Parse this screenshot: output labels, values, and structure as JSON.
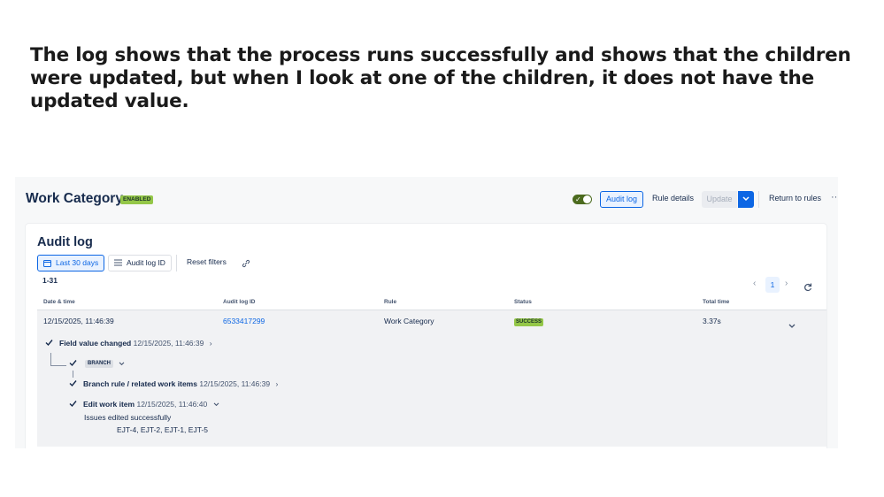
{
  "headline": "The log shows that the process runs successfully and shows that the children were updated, but when I look at one of the children, it does not have the updated value.",
  "header": {
    "title": "Work Category",
    "status_badge": "ENABLED",
    "audit_log_button": "Audit log",
    "rule_details_button": "Rule details",
    "update_button": "Update",
    "return_button": "Return to rules",
    "more_icon": "ellipsis-icon"
  },
  "panel": {
    "title": "Audit log",
    "filters": {
      "date_range": "Last 30 days",
      "audit_log_id": "Audit log ID",
      "reset": "Reset filters"
    },
    "count": "1-31",
    "pagination": {
      "current_page": "1"
    },
    "columns": [
      "Date & time",
      "Audit log ID",
      "Rule",
      "Status",
      "Total time"
    ],
    "row": {
      "date_time": "12/15/2025, 11:46:39",
      "audit_id": "6533417299",
      "rule": "Work Category",
      "status": "SUCCESS",
      "total_time": "3.37s"
    },
    "tree": {
      "field_changed": {
        "label": "Field value changed",
        "time": "12/15/2025, 11:46:39"
      },
      "branch": {
        "badge": "BRANCH"
      },
      "branch_rule": {
        "label": "Branch rule / related work items",
        "time": "12/15/2025, 11:46:39"
      },
      "edit_item": {
        "label": "Edit work item",
        "time": "12/15/2025, 11:46:40",
        "message": "Issues edited successfully",
        "issues": "EJT-4, EJT-2, EJT-1, EJT-5"
      }
    }
  },
  "colors": {
    "accent": "#0c66e4",
    "success_badge": "#94c748",
    "row_background": "#f1f2f4"
  }
}
